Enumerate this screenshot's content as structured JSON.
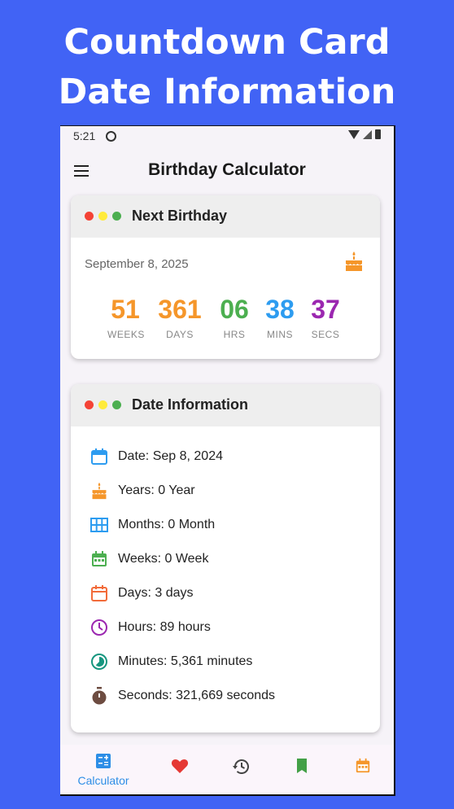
{
  "promo": {
    "line1": "Countdown Card",
    "line2": "Date Information"
  },
  "status_bar": {
    "time": "5:21"
  },
  "app_bar": {
    "title": "Birthday Calculator",
    "menu_icon": "menu-icon"
  },
  "next_birthday": {
    "title": "Next Birthday",
    "date": "September 8, 2025",
    "icon": "cake-icon",
    "countdown": [
      {
        "value": "51",
        "label": "WEEKS",
        "color": "#f5962a"
      },
      {
        "value": "361",
        "label": "DAYS",
        "color": "#f5962a"
      },
      {
        "value": "06",
        "label": "HRS",
        "color": "#4caf50"
      },
      {
        "value": "38",
        "label": "MINS",
        "color": "#2d9cf0"
      },
      {
        "value": "37",
        "label": "SECS",
        "color": "#9b27b0"
      }
    ]
  },
  "date_information": {
    "title": "Date Information",
    "items": [
      {
        "text": "Date: Sep 8, 2024",
        "icon": "calendar-icon",
        "color": "#2d9cf0"
      },
      {
        "text": "Years: 0 Year",
        "icon": "cake-icon",
        "color": "#f5962a"
      },
      {
        "text": "Months: 0 Month",
        "icon": "grid-icon",
        "color": "#2d9cf0"
      },
      {
        "text": "Weeks: 0 Week",
        "icon": "calendar-week-icon",
        "color": "#4caf50"
      },
      {
        "text": "Days: 3 days",
        "icon": "calendar-day-icon",
        "color": "#f26b3a"
      },
      {
        "text": "Hours: 89 hours",
        "icon": "clock-icon",
        "color": "#9b27b0"
      },
      {
        "text": "Minutes: 5,361 minutes",
        "icon": "timelapse-icon",
        "color": "#16967f"
      },
      {
        "text": "Seconds: 321,669 seconds",
        "icon": "timer-icon",
        "color": "#6d4c41"
      }
    ]
  },
  "window_dots": [
    "#f44336",
    "#ffeb3b",
    "#4caf50"
  ],
  "bottom_nav": {
    "items": [
      {
        "label": "Calculator",
        "icon": "calculator-icon",
        "color": "#2d8ee6",
        "active": true
      },
      {
        "label": "",
        "icon": "heart-icon",
        "color": "#e53935",
        "active": false
      },
      {
        "label": "",
        "icon": "history-icon",
        "color": "#444444",
        "active": false
      },
      {
        "label": "",
        "icon": "bookmark-icon",
        "color": "#43a047",
        "active": false
      },
      {
        "label": "",
        "icon": "calendar-icon",
        "color": "#f5962a",
        "active": false
      }
    ]
  }
}
